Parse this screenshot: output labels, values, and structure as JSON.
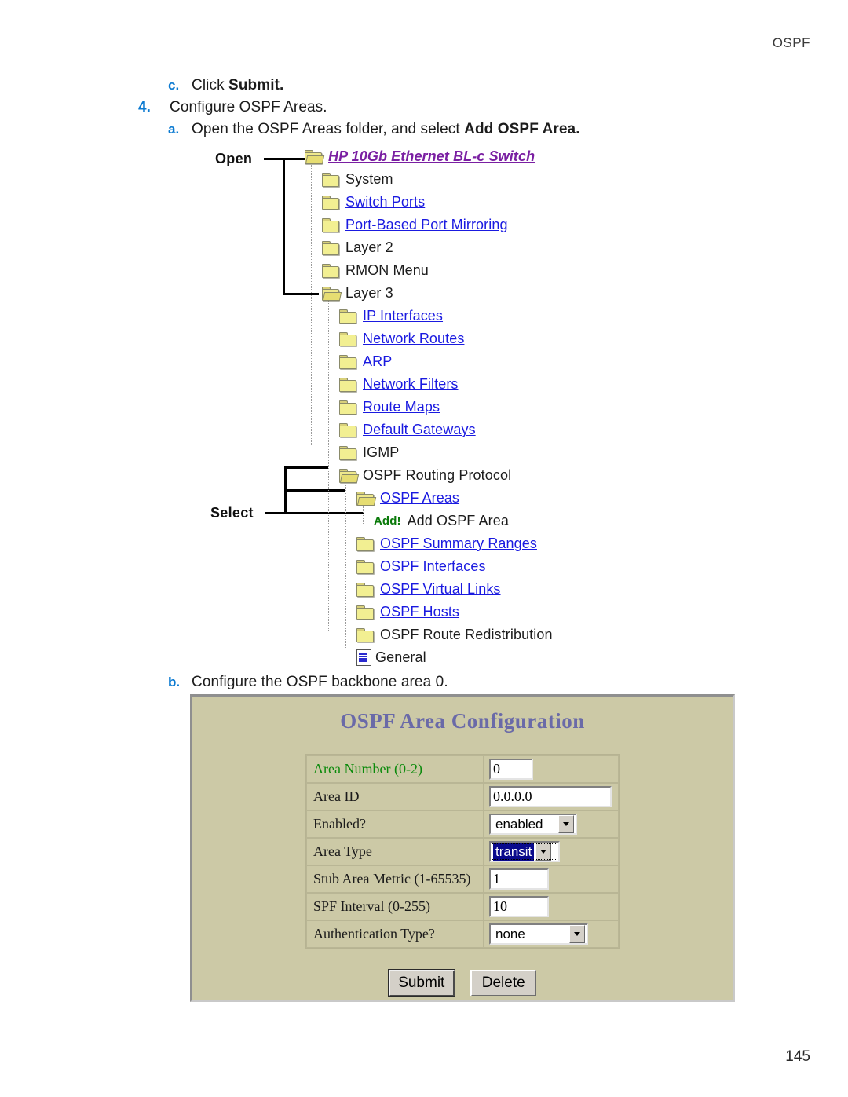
{
  "page": {
    "running_head": "OSPF",
    "folio": "145"
  },
  "steps": [
    {
      "marker": "c.",
      "level": "sub",
      "text_before": "Click ",
      "bold": "Submit.",
      "text_after": ""
    },
    {
      "marker": "4.",
      "level": "main",
      "text_before": "Configure OSPF Areas.",
      "bold": "",
      "text_after": ""
    },
    {
      "marker": "a.",
      "level": "sub",
      "text_before": "Open the OSPF Areas folder, and select ",
      "bold": "Add OSPF Area.",
      "text_after": ""
    }
  ],
  "step_b": {
    "marker": "b.",
    "text": "Configure the OSPF backbone area 0."
  },
  "figure": {
    "callout_open": "Open",
    "callout_select": "Select",
    "tree": [
      {
        "label": "HP 10Gb Ethernet BL-c Switch",
        "icon": "folder-open-icon",
        "style": "root",
        "indent": 0
      },
      {
        "label": "System",
        "icon": "folder-icon",
        "style": "plain",
        "indent": 1
      },
      {
        "label": "Switch Ports",
        "icon": "folder-icon",
        "style": "link",
        "indent": 1
      },
      {
        "label": "Port-Based Port Mirroring",
        "icon": "folder-icon",
        "style": "link",
        "indent": 1
      },
      {
        "label": "Layer 2",
        "icon": "folder-icon",
        "style": "plain",
        "indent": 1
      },
      {
        "label": "RMON Menu",
        "icon": "folder-icon",
        "style": "plain",
        "indent": 1
      },
      {
        "label": "Layer 3",
        "icon": "folder-open-icon",
        "style": "plain",
        "indent": 1
      },
      {
        "label": "IP Interfaces",
        "icon": "folder-icon",
        "style": "link",
        "indent": 2
      },
      {
        "label": "Network Routes",
        "icon": "folder-icon",
        "style": "link",
        "indent": 2
      },
      {
        "label": "ARP",
        "icon": "folder-icon",
        "style": "link",
        "indent": 2
      },
      {
        "label": "Network Filters",
        "icon": "folder-icon",
        "style": "link",
        "indent": 2
      },
      {
        "label": "Route Maps",
        "icon": "folder-icon",
        "style": "link",
        "indent": 2
      },
      {
        "label": "Default Gateways",
        "icon": "folder-icon",
        "style": "link",
        "indent": 2
      },
      {
        "label": "IGMP",
        "icon": "folder-icon",
        "style": "plain",
        "indent": 2
      },
      {
        "label": "OSPF Routing Protocol",
        "icon": "folder-open-icon",
        "style": "plain",
        "indent": 2
      },
      {
        "label": "OSPF Areas",
        "icon": "folder-open-icon",
        "style": "link",
        "indent": 3
      },
      {
        "label": "Add OSPF Area",
        "icon": "add-icon",
        "style": "add",
        "indent": 4,
        "prefix": "Add!"
      },
      {
        "label": "OSPF Summary Ranges",
        "icon": "folder-icon",
        "style": "link",
        "indent": 3
      },
      {
        "label": "OSPF Interfaces",
        "icon": "folder-icon",
        "style": "link",
        "indent": 3
      },
      {
        "label": "OSPF Virtual Links",
        "icon": "folder-icon",
        "style": "link",
        "indent": 3
      },
      {
        "label": "OSPF Hosts",
        "icon": "folder-icon",
        "style": "link",
        "indent": 3
      },
      {
        "label": "OSPF Route Redistribution",
        "icon": "folder-icon",
        "style": "plain",
        "indent": 3
      },
      {
        "label": "General",
        "icon": "document-icon",
        "style": "plain",
        "indent": 3
      }
    ]
  },
  "screenshot": {
    "title": "OSPF Area Configuration",
    "fields": [
      {
        "label": "Area Number (0-2)",
        "label_color": "#0b8a0b",
        "control": "text",
        "value": "0",
        "width": "w-sm"
      },
      {
        "label": "Area ID",
        "label_color": "#1a1a1a",
        "control": "text",
        "value": "0.0.0.0",
        "width": "w-lg"
      },
      {
        "label": "Enabled?",
        "label_color": "#1a1a1a",
        "control": "select",
        "value": "enabled",
        "width": "w-en"
      },
      {
        "label": "Area Type",
        "label_color": "#1a1a1a",
        "control": "select",
        "value": "transit",
        "width": "w-tr",
        "selected": true
      },
      {
        "label": "Stub Area Metric (1-65535)",
        "label_color": "#1a1a1a",
        "control": "text",
        "value": "1",
        "width": "w-md"
      },
      {
        "label": "SPF Interval (0-255)",
        "label_color": "#1a1a1a",
        "control": "text",
        "value": "10",
        "width": "w-md"
      },
      {
        "label": "Authentication Type?",
        "label_color": "#1a1a1a",
        "control": "select",
        "value": "none",
        "width": "w-au"
      }
    ],
    "buttons": [
      {
        "label": "Submit",
        "default": true
      },
      {
        "label": "Delete",
        "default": false
      }
    ]
  },
  "colors": {
    "step_marker": "#0b7ad1",
    "tree_link": "#1a1ae0",
    "tree_root": "#7a1fa2",
    "add_green": "#0a7a0a",
    "form_bg": "#ccc9a6",
    "form_title": "#6a6aa8",
    "select_highlight": "#0a0a8c"
  }
}
